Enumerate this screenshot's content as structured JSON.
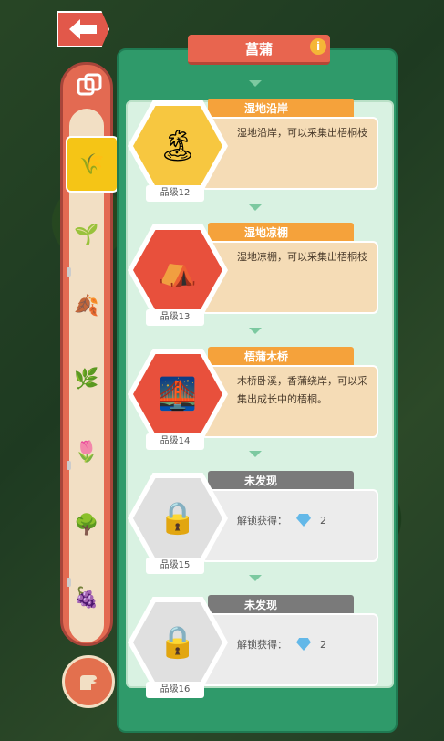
{
  "title": "菖蒲",
  "info_icon": "i",
  "cards": [
    {
      "name": "湿地沿岸",
      "desc": "湿地沿岸，可以采集出梧桐枝",
      "grade": "品级12",
      "locked": false,
      "color": "#f7c740"
    },
    {
      "name": "湿地凉棚",
      "desc": "湿地凉棚，可以采集出梧桐枝",
      "grade": "品级13",
      "locked": false,
      "color": "#e8503c"
    },
    {
      "name": "梧蒲木桥",
      "desc": "木桥卧溪，香蒲绕岸，可以采集出成长中的梧桐。",
      "grade": "品级14",
      "locked": false,
      "color": "#e8503c"
    },
    {
      "name": "未发现",
      "unlock_label": "解锁获得：",
      "unlock_count": "2",
      "grade": "品级15",
      "locked": true
    },
    {
      "name": "未发现",
      "unlock_label": "解锁获得：",
      "unlock_count": "2",
      "grade": "品级16",
      "locked": true
    }
  ],
  "sidebar_icons": [
    "reed-icon",
    "sprout-icon",
    "leaf-icon",
    "bush-icon",
    "bud-icon",
    "tree-icon",
    "grape-icon"
  ]
}
